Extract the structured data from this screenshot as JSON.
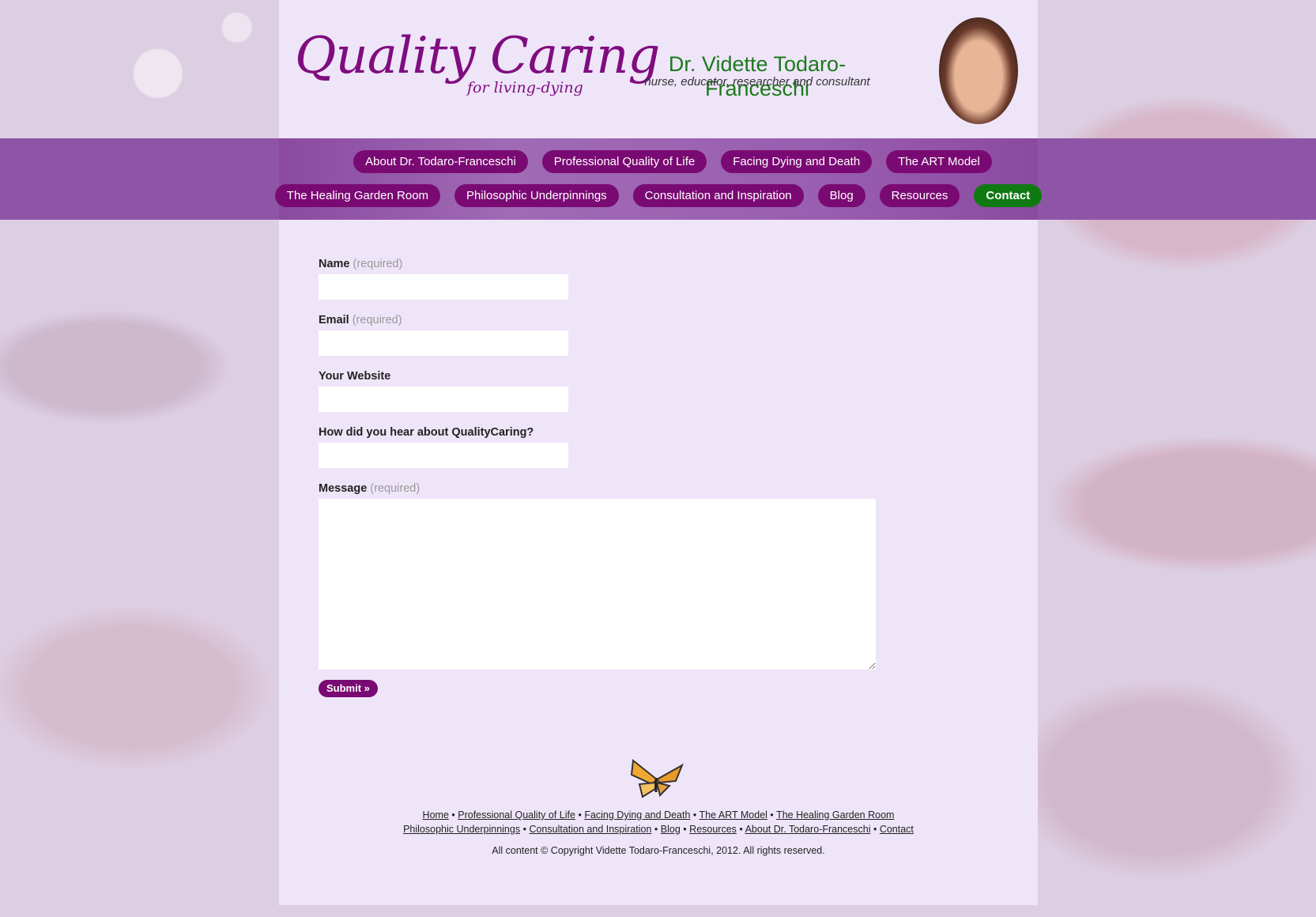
{
  "header": {
    "logo_title": "Quality Caring",
    "logo_subtitle": "for living-dying",
    "doctor_name": "Dr. Vidette Todaro-Franceschi",
    "tagline": "nurse, educator, researcher and consultant"
  },
  "nav": {
    "row1": [
      "About Dr. Todaro-Franceschi",
      "Professional Quality of Life",
      "Facing Dying and Death",
      "The ART Model"
    ],
    "row2": [
      "The Healing Garden Room",
      "Philosophic Underpinnings",
      "Consultation and Inspiration",
      "Blog",
      "Resources",
      "Contact"
    ],
    "active": "Contact",
    "active_color": "#0f7a12",
    "pill_color": "#7a0a73"
  },
  "form": {
    "name_label": "Name",
    "name_req": "(required)",
    "email_label": "Email",
    "email_req": "(required)",
    "website_label": "Your Website",
    "hear_label": "How did you hear about QualityCaring?",
    "message_label": "Message",
    "message_req": "(required)",
    "submit_label": "Submit »"
  },
  "footer": {
    "links_row1": [
      "Home",
      "Professional Quality of Life",
      "Facing Dying and Death",
      "The ART Model",
      "The Healing Garden Room"
    ],
    "links_row2": [
      "Philosophic Underpinnings",
      "Consultation and Inspiration",
      "Blog",
      "Resources",
      "About Dr. Todaro-Franceschi",
      "Contact"
    ],
    "separator": "•",
    "copyright": "All content © Copyright Vidette Todaro-Franceschi, 2012. All rights reserved."
  }
}
